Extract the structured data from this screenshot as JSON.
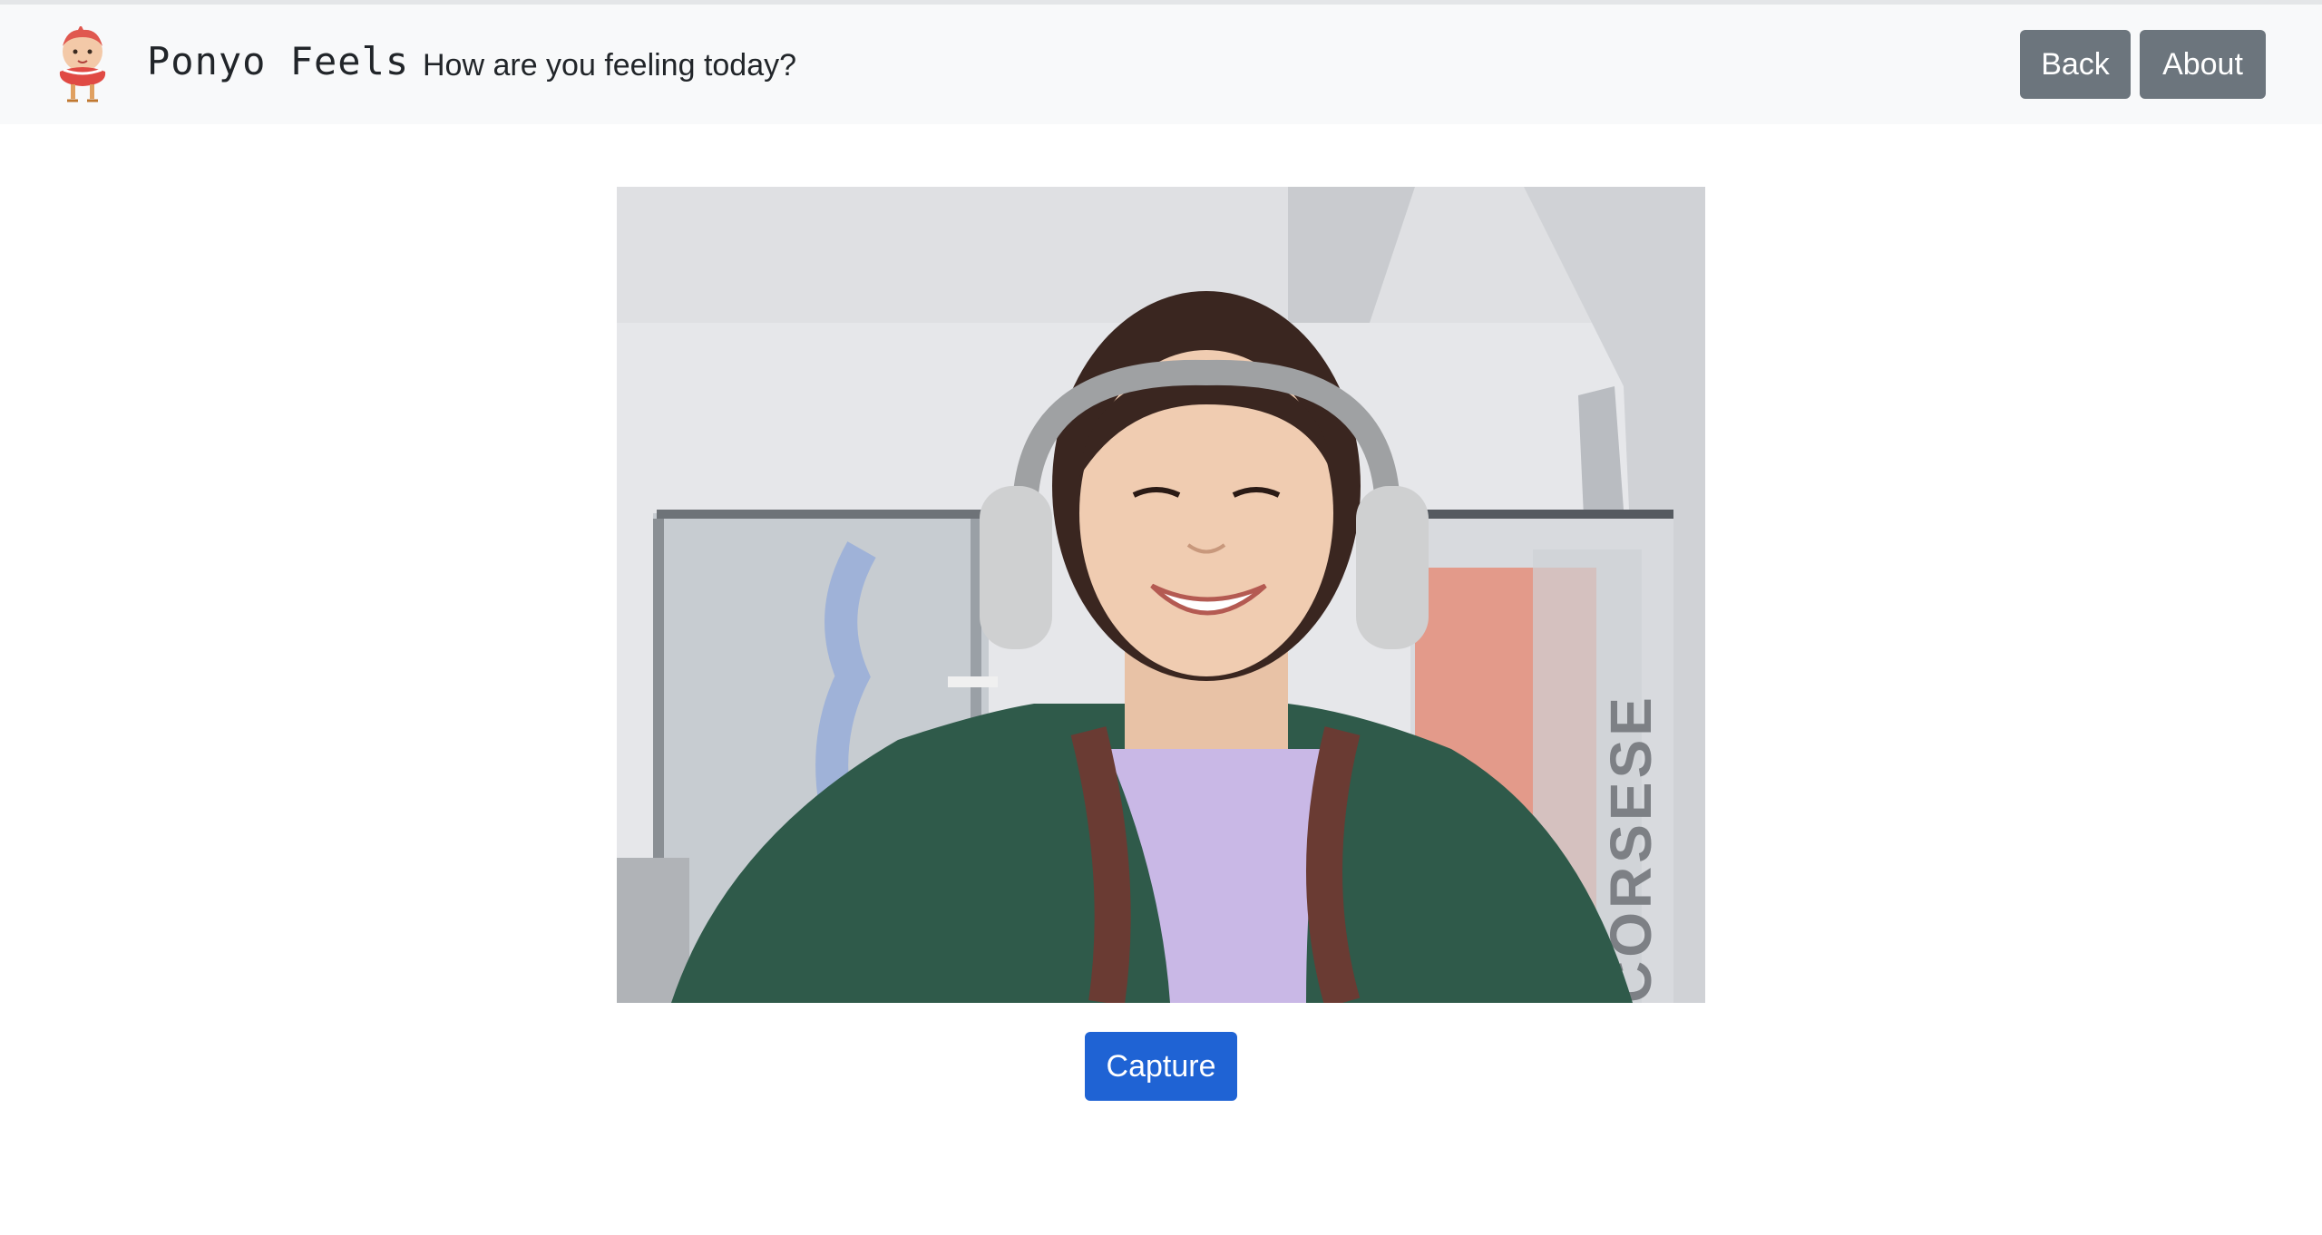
{
  "header": {
    "brand": "Ponyo Feels",
    "tagline": "How are you feeling today?",
    "back_label": "Back",
    "about_label": "About",
    "logo_icon": "ponyo-logo-icon"
  },
  "camera": {
    "wall_text": "CORSESE"
  },
  "actions": {
    "capture_label": "Capture",
    "capture_color": "#1f63d4"
  }
}
